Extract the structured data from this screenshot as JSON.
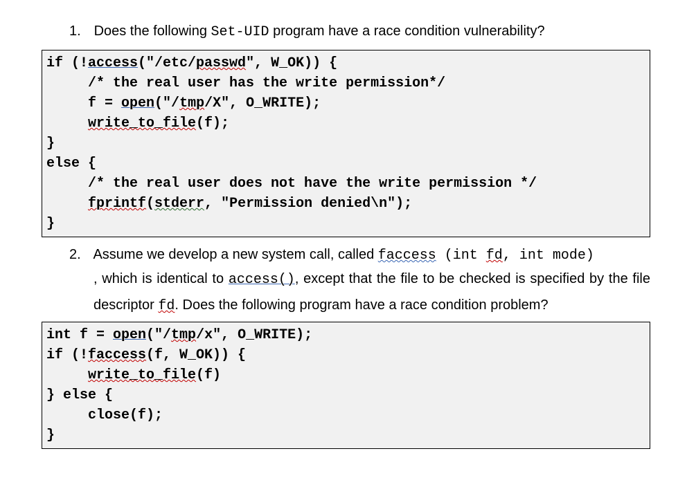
{
  "q1": {
    "num": "1.",
    "pre": "Does the following ",
    "mono": "Set-UID",
    "post": " program have a race condition vulnerability?"
  },
  "code1": {
    "l1a": "if (!",
    "l1b": "access",
    "l1c": "(\"/etc/",
    "l1d": "passwd",
    "l1e": "\", W_OK)) {",
    "l2": "     /* the real user has the write permission*/",
    "l3a": "     f = ",
    "l3b": "open",
    "l3c": "(\"/",
    "l3d": "tmp",
    "l3e": "/X\", O_WRITE);",
    "l4a": "     ",
    "l4b": "write_to_file",
    "l4c": "(f);",
    "l5": "}",
    "l6": "else {",
    "l7": "     /* the real user does not have the write permission */",
    "l8a": "     ",
    "l8b": "fprintf",
    "l8c": "(",
    "l8d": "stderr",
    "l8e": ", \"Permission denied\\n\");",
    "l9": "}"
  },
  "q2": {
    "num": "2.",
    "p1a": "Assume we develop a new system call, called ",
    "p1b": "faccess",
    "p1c": " (int ",
    "p1d": "fd",
    "p1e": ", int mode)",
    "p1f": ", which is identical to ",
    "p1g": "access()",
    "p1h": ", except that the file to be checked is specified by the file descriptor ",
    "p1i": "fd",
    "p1j": ". Does the following program have a race condition problem?"
  },
  "code2": {
    "l1a": "int f = ",
    "l1b": "open",
    "l1c": "(\"/",
    "l1d": "tmp",
    "l1e": "/x\", O_WRITE);",
    "l2a": "if (!",
    "l2b": "faccess",
    "l2c": "(f, W_OK)) {",
    "l3a": "     ",
    "l3b": "write_to_file",
    "l3c": "(f)",
    "l4": "} else {",
    "l5": "     close(f);",
    "l6": "}"
  }
}
